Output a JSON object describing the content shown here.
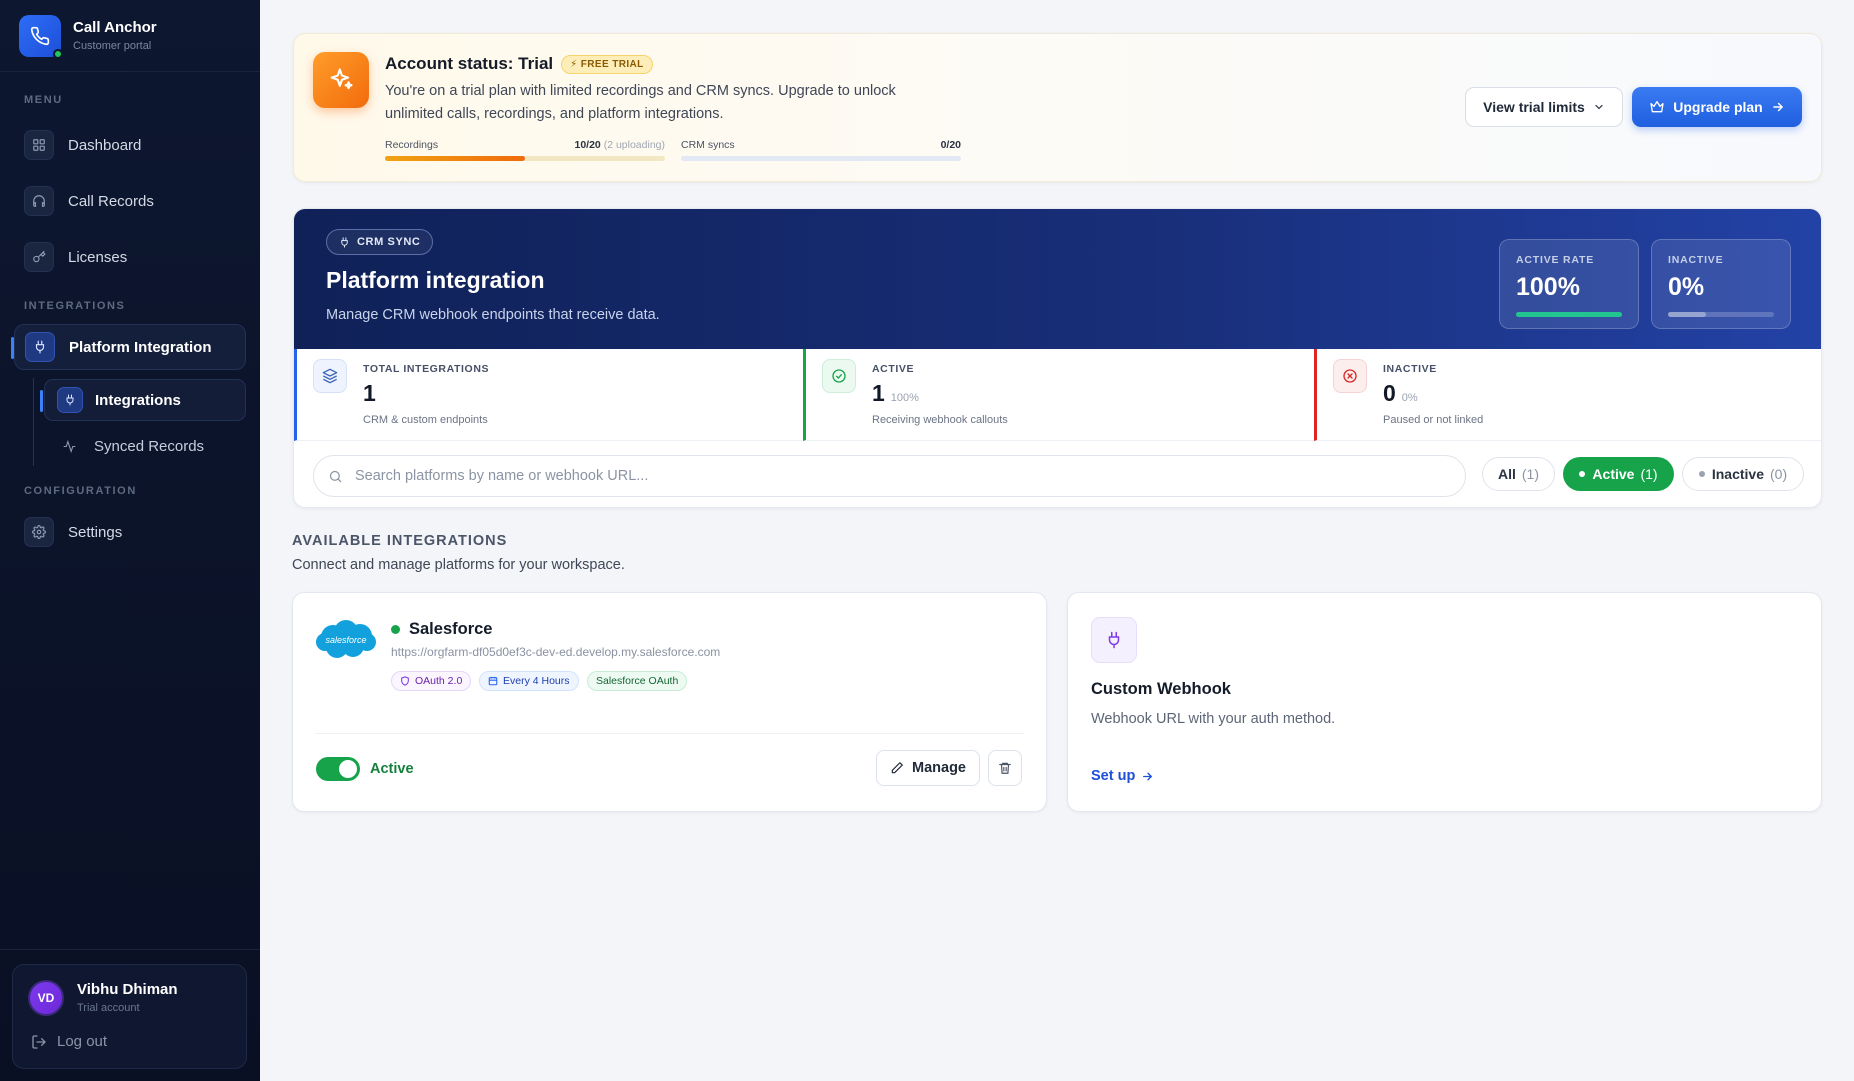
{
  "sidebar": {
    "brand_title": "Call Anchor",
    "brand_sub": "Customer portal",
    "menu_label": "MENU",
    "integrations_label": "INTEGRATIONS",
    "configuration_label": "CONFIGURATION",
    "items": {
      "dashboard": "Dashboard",
      "call_records": "Call Records",
      "licenses": "Licenses",
      "platform_integration": "Platform Integration",
      "integrations": "Integrations",
      "synced_records": "Synced Records",
      "settings": "Settings"
    },
    "user": {
      "initials": "VD",
      "name": "Vibhu Dhiman",
      "role": "Trial account",
      "logout": "Log out"
    }
  },
  "trial": {
    "title": "Account status: Trial",
    "badge": "FREE TRIAL",
    "desc": "You're on a trial plan with limited recordings and CRM syncs. Upgrade to unlock unlimited calls, recordings, and platform integrations.",
    "recordings_label": "Recordings",
    "recordings_value": "10/20",
    "recordings_note": "(2 uploading)",
    "recordings_fraction": 0.5,
    "crm_label": "CRM syncs",
    "crm_value": "0/20",
    "crm_fraction": 0,
    "view_limits": "View trial limits",
    "upgrade": "Upgrade plan"
  },
  "hero": {
    "badge": "CRM SYNC",
    "title": "Platform integration",
    "subtitle": "Manage CRM webhook endpoints that receive data.",
    "active_rate_label": "ACTIVE RATE",
    "active_rate_value": "100%",
    "inactive_label": "INACTIVE",
    "inactive_value": "0%"
  },
  "stats": {
    "total_label": "TOTAL INTEGRATIONS",
    "total_value": "1",
    "total_desc": "CRM & custom endpoints",
    "active_label": "ACTIVE",
    "active_value": "1",
    "active_pct": "100%",
    "active_desc": "Receiving webhook callouts",
    "inactive_label": "INACTIVE",
    "inactive_value": "0",
    "inactive_pct": "0%",
    "inactive_desc": "Paused or not linked"
  },
  "filters": {
    "search_placeholder": "Search platforms by name or webhook URL...",
    "all_label": "All",
    "all_count": "(1)",
    "active_label": "Active",
    "active_count": "(1)",
    "inactive_label": "Inactive",
    "inactive_count": "(0)"
  },
  "available": {
    "title": "AVAILABLE INTEGRATIONS",
    "subtitle": "Connect and manage platforms for your workspace."
  },
  "salesforce": {
    "logo_text": "salesforce",
    "name": "Salesforce",
    "url": "https://orgfarm-df05d0ef3c-dev-ed.develop.my.salesforce.com",
    "tag_oauth": "OAuth 2.0",
    "tag_schedule": "Every 4 Hours",
    "tag_type": "Salesforce OAuth",
    "status": "Active",
    "manage": "Manage"
  },
  "custom_webhook": {
    "title": "Custom Webhook",
    "subtitle": "Webhook URL with your auth method.",
    "setup": "Set up"
  },
  "colors": {
    "accent": "#1f5fe0",
    "success": "#16a34a",
    "danger": "#dc2626",
    "warning": "#f06a0c"
  }
}
